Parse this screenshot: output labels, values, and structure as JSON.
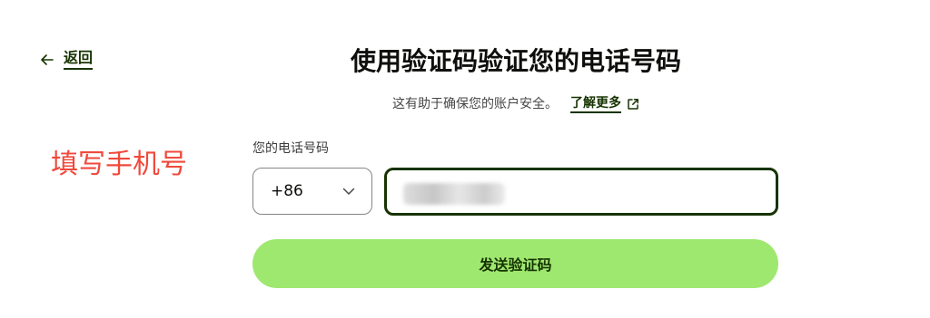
{
  "nav": {
    "back_label": "返回",
    "back_icon": "arrow-left-icon"
  },
  "header": {
    "title": "使用验证码验证您的电话号码",
    "subtitle": "这有助于确保您的账户安全。",
    "learn_more_label": "了解更多",
    "external_icon": "external-link-icon"
  },
  "annotation": {
    "text": "填写手机号",
    "color": "#ef4a3c"
  },
  "form": {
    "phone_label": "您的电话号码",
    "country_code": "+86",
    "chevron_icon": "chevron-down-icon",
    "phone_value": "",
    "submit_label": "发送验证码"
  },
  "colors": {
    "accent": "#9fe870",
    "brand_dark": "#163300",
    "annotation": "#ef4a3c"
  }
}
